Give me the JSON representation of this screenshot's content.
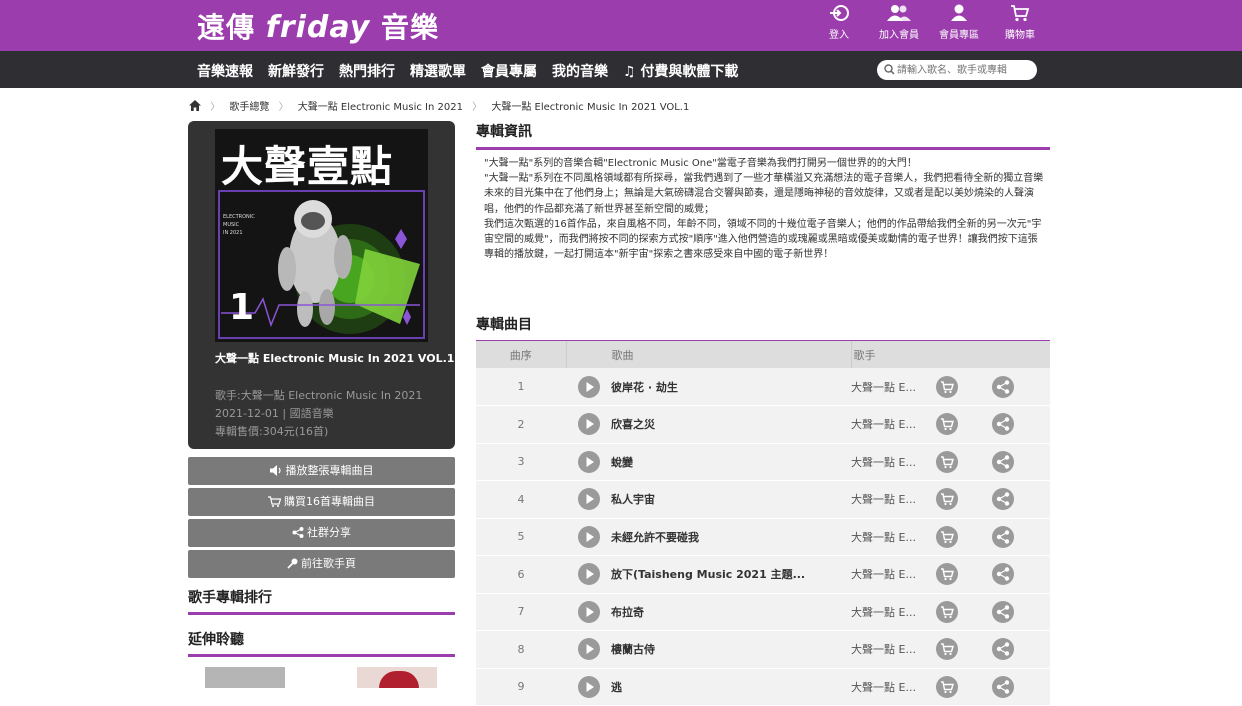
{
  "header": {
    "logo_left": "遠傳",
    "logo_mid": "friday",
    "logo_right": "音樂",
    "buttons": [
      {
        "label": "登入",
        "icon": "login-icon"
      },
      {
        "label": "加入會員",
        "icon": "add-member-icon"
      },
      {
        "label": "會員專區",
        "icon": "member-icon"
      },
      {
        "label": "購物車",
        "icon": "cart-icon"
      }
    ]
  },
  "nav": {
    "items": [
      "音樂速報",
      "新鮮發行",
      "熱門排行",
      "精選歌單",
      "會員專屬",
      "我的音樂",
      "付費與軟體下載"
    ],
    "search_placeholder": "請輸入歌名、歌手或專輯"
  },
  "breadcrumb": [
    "歌手總覽",
    "大聲一點 Electronic Music In 2021",
    "大聲一點 Electronic Music In 2021 VOL.1"
  ],
  "album": {
    "cover_title": "大聲壹點",
    "cover_small": [
      "ELECTRONIC",
      "MUSIC",
      "IN 2021"
    ],
    "cover_number": "1",
    "name": "大聲一點 Electronic Music In 2021 VOL.1",
    "artist": "歌手:大聲一點 Electronic Music In 2021",
    "date_genre": "2021-12-01 | 國語音樂",
    "price": "專輯售價:304元(16首)"
  },
  "actions": [
    "播放整張專輯曲目",
    "購買16首專輯曲目",
    "社群分享",
    "前往歌手頁"
  ],
  "sidebar": {
    "ranking_title": "歌手專輯排行",
    "extended_title": "延伸聆聽"
  },
  "info": {
    "title": "專輯資訊",
    "paragraphs": [
      "\"大聲一點\"系列的音樂合輯\"Electronic Music One\"當電子音樂為我們打開另一個世界的的大門！",
      "\"大聲一點\"系列在不同風格領域都有所探尋，當我們遇到了一些才華橫溢又充滿想法的電子音樂人，我們把看待全新的獨立音樂未來的目光集中在了他們身上；無論是大氣磅礴混合交響與節奏，還是隱晦神秘的音效旋律，又或者是配以美妙燒染的人聲演唱，他們的作品都充滿了新世界甚至新空間的威覺；",
      "我們這次甄選的16首作品，來自風格不同，年齡不同，領域不同的十幾位電子音樂人；他們的作品帶給我們全新的另一次元\"宇宙空間的威覺\"，而我們將按不同的探索方式按\"順序\"進入他們營造的或瑰麗或黑暗或優美或動情的電子世界！讓我們按下這張專輯的播放鍵，一起打開這本\"新宇宙\"探索之書來感受來自中國的電子新世界！"
    ]
  },
  "tracklist": {
    "title": "專輯曲目",
    "headers": {
      "no": "曲序",
      "song": "歌曲",
      "artist": "歌手"
    },
    "rows": [
      {
        "no": "1",
        "song": "彼岸花 · 劫生",
        "artist": "大聲一點 E..."
      },
      {
        "no": "2",
        "song": "欣喜之災",
        "artist": "大聲一點 E..."
      },
      {
        "no": "3",
        "song": "蛻變",
        "artist": "大聲一點 E..."
      },
      {
        "no": "4",
        "song": "私人宇宙",
        "artist": "大聲一點 E..."
      },
      {
        "no": "5",
        "song": "未經允許不要碰我",
        "artist": "大聲一點 E..."
      },
      {
        "no": "6",
        "song": "放下(Taisheng Music 2021 主題...",
        "artist": "大聲一點 E..."
      },
      {
        "no": "7",
        "song": "布拉奇",
        "artist": "大聲一點 E..."
      },
      {
        "no": "8",
        "song": "樓蘭古侍",
        "artist": "大聲一點 E..."
      },
      {
        "no": "9",
        "song": "逃",
        "artist": "大聲一點 E..."
      }
    ]
  },
  "colors": {
    "brand": "#9c3dae",
    "navbar": "#2e2e33",
    "button": "#7a7a7a"
  }
}
